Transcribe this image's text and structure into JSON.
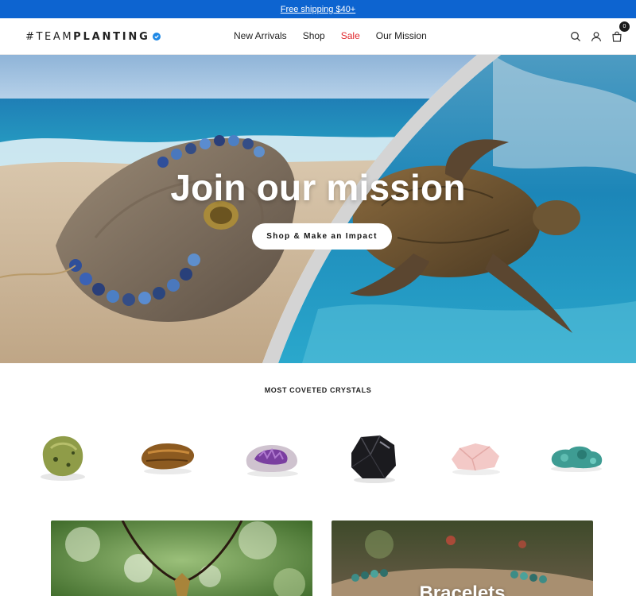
{
  "announcement": {
    "text": "Free shipping $40+"
  },
  "header": {
    "logo_prefix": "#TEAM",
    "logo_bold": "PLANTING",
    "nav": [
      "New Arrivals",
      "Shop",
      "Sale",
      "Our Mission"
    ],
    "cart_count": "0",
    "icons": [
      "search-icon",
      "account-icon",
      "cart-icon"
    ]
  },
  "hero": {
    "title": "Join our mission",
    "cta": "Shop & Make an Impact"
  },
  "crystals_section": {
    "title": "MOST COVETED CRYSTALS",
    "items": [
      "green-crystal",
      "tigers-eye-crystal",
      "amethyst-crystal",
      "obsidian-crystal",
      "rose-quartz-crystal",
      "turquoise-crystal"
    ]
  },
  "categories": [
    {
      "label": ""
    },
    {
      "label": "Bracelets"
    }
  ],
  "colors": {
    "announcement_bg": "#0d64d0",
    "sale": "#e0262b",
    "verified": "#1e88e5"
  }
}
